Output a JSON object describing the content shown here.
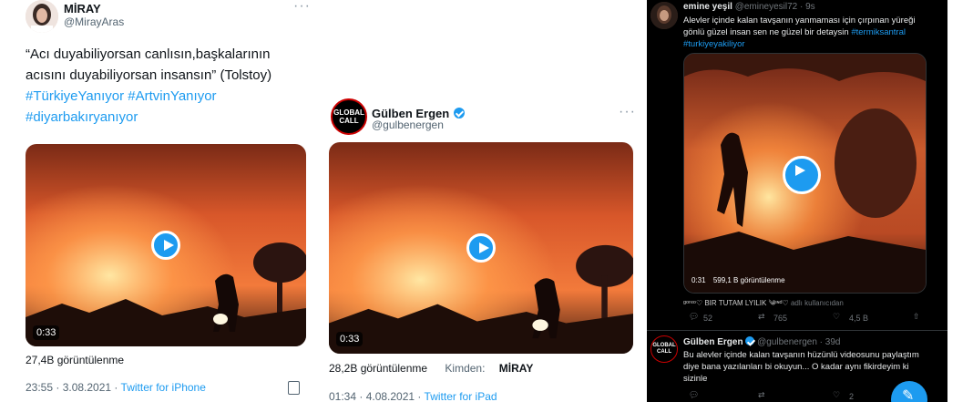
{
  "tweet1": {
    "name": "MİRAY",
    "handle": "@MirayAras",
    "quote": "“Acı duyabiliyorsan canlısın,başkalarının acısını duyabiliyorsan insansın” (Tolstoy)",
    "hashtags": "#TürkiyeYanıyor #ArtvinYanıyor",
    "hashtag2": "#diyarbakıryanıyor",
    "duration": "0:33",
    "views": "27,4B görüntülenme",
    "time": "23:55 · 3.08.2021 · ",
    "source": "Twitter for iPhone"
  },
  "tweet2": {
    "name": "Gülben Ergen",
    "handle": "@gulbenergen",
    "avatar_text": "GLOBAL CALL",
    "duration": "0:33",
    "views": "28,2B görüntülenme",
    "from_label": "Kimden:",
    "from_name": "MİRAY",
    "time": "01:34 · 4.08.2021 · ",
    "source": "Twitter for iPad"
  },
  "tweet3": {
    "name": "emine yeşil",
    "handle": "@emineyesil72 · 9s",
    "text": "Alevler içinde kalan tavşanın yanmaması için çırpınan yüreği gönlü güzel insan sen ne güzel bir detaysin ",
    "hashtag": "#termiksantral",
    "hashtag2": "#turkiyeyakiliyor",
    "duration": "0:31",
    "views": "599,1 B görüntülenme",
    "fancy": "ᵍᵒʳᵉᵒ♡ BIR TUTAM LYILIK ༄ᶦᶰᵈ♡",
    "fancy_suffix": "adlı kullanıcıdan",
    "replies": "52",
    "retweets": "765",
    "likes": "4,5 B"
  },
  "tweet4": {
    "name": "Gülben Ergen",
    "handle": "@gulbenergen · 39d",
    "avatar_text": "GLOBAL CALL",
    "text": "Bu alevler içinde kalan tavşanın hüzünlü videosunu paylaştım diye bana yazılanları bi okuyun... O kadar aynı fikirdeyim ki sizinle",
    "likes": "2"
  },
  "colors": {
    "accent": "#1d9bf0",
    "dark_bg": "#000000",
    "fire_a": "#f0641e",
    "fire_b": "#ffb347"
  },
  "icons": [
    "more-icon",
    "play-icon",
    "verified-icon",
    "reply-icon",
    "retweet-icon",
    "like-icon",
    "share-icon",
    "compose-icon",
    "analytics-icon"
  ]
}
